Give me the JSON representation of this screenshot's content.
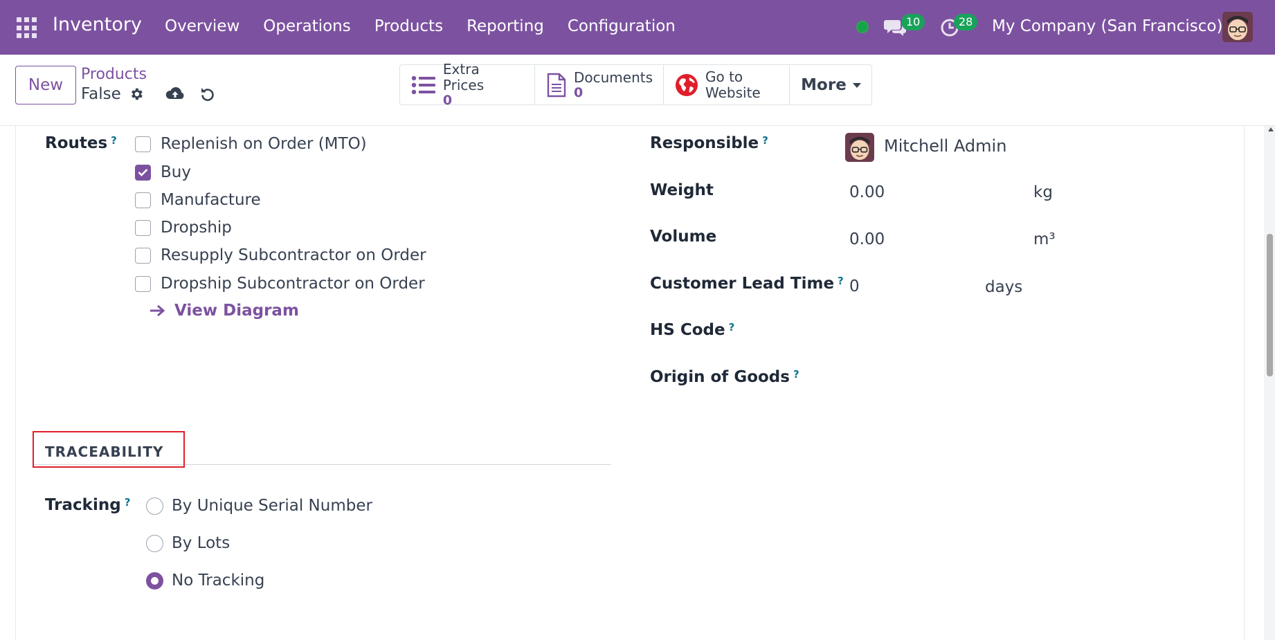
{
  "navbar": {
    "app_name": "Inventory",
    "menu": [
      "Overview",
      "Operations",
      "Products",
      "Reporting",
      "Configuration"
    ],
    "chat_count": "10",
    "activity_count": "28",
    "company": "My Company (San Francisco)",
    "accent_color": "#7c52a0"
  },
  "control": {
    "new_label": "New",
    "breadcrumb_parent": "Products",
    "breadcrumb_current": "False",
    "smart_buttons": {
      "extra_prices": {
        "label": "Extra Prices",
        "value": "0"
      },
      "documents": {
        "label": "Documents",
        "value": "0"
      },
      "website": {
        "line1": "Go to",
        "line2": "Website"
      },
      "more": "More"
    }
  },
  "form": {
    "routes_label": "Routes",
    "routes": [
      {
        "label": "Replenish on Order (MTO)",
        "checked": false
      },
      {
        "label": "Buy",
        "checked": true
      },
      {
        "label": "Manufacture",
        "checked": false
      },
      {
        "label": "Dropship",
        "checked": false
      },
      {
        "label": "Resupply Subcontractor on Order",
        "checked": false
      },
      {
        "label": "Dropship Subcontractor on Order",
        "checked": false
      }
    ],
    "view_diagram": "View Diagram",
    "right": {
      "responsible_label": "Responsible",
      "responsible_value": "Mitchell Admin",
      "weight_label": "Weight",
      "weight_value": "0.00",
      "weight_unit": "kg",
      "volume_label": "Volume",
      "volume_value": "0.00",
      "volume_unit": "m³",
      "lead_time_label": "Customer Lead Time",
      "lead_time_value": "0",
      "lead_time_unit": "days",
      "hs_code_label": "HS Code",
      "origin_label": "Origin of Goods"
    },
    "traceability": {
      "title": "TRACEABILITY",
      "tracking_label": "Tracking",
      "options": [
        {
          "label": "By Unique Serial Number",
          "selected": false
        },
        {
          "label": "By Lots",
          "selected": false
        },
        {
          "label": "No Tracking",
          "selected": true
        }
      ]
    },
    "help_mark": "?"
  }
}
